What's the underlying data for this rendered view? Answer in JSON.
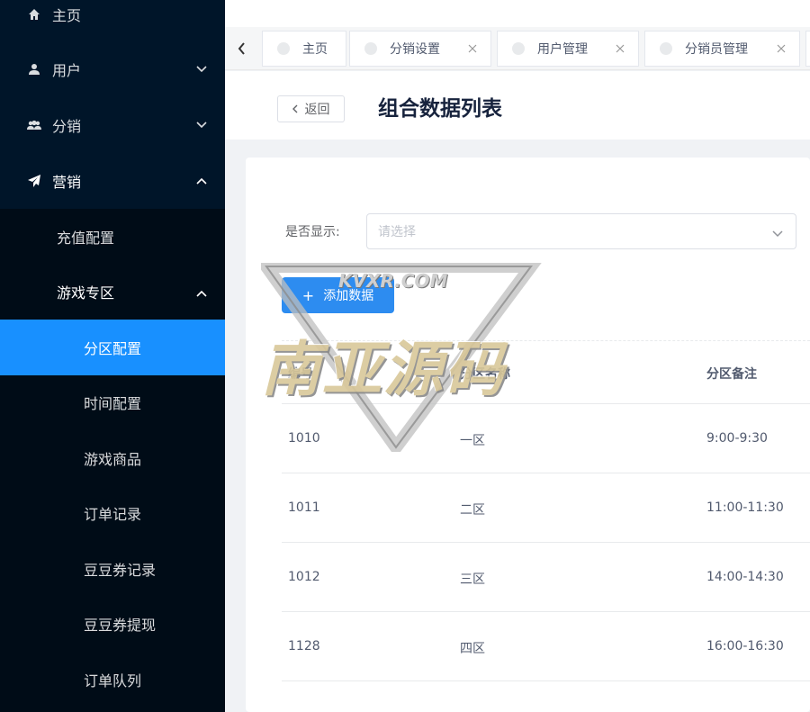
{
  "sidebar": {
    "top_items": [
      {
        "label": "主页",
        "icon": "home-icon",
        "expanded": null
      },
      {
        "label": "用户",
        "icon": "user-icon",
        "expanded": false
      },
      {
        "label": "分销",
        "icon": "group-icon",
        "expanded": false
      },
      {
        "label": "营销",
        "icon": "send-icon",
        "expanded": true
      }
    ],
    "marketing_children": [
      {
        "label": "充值配置"
      },
      {
        "label": "游戏专区",
        "expanded": true
      }
    ],
    "game_children": [
      {
        "label": "分区配置",
        "active": true
      },
      {
        "label": "时间配置"
      },
      {
        "label": "游戏商品"
      },
      {
        "label": "订单记录"
      },
      {
        "label": "豆豆券记录"
      },
      {
        "label": "豆豆券提现"
      },
      {
        "label": "订单队列"
      }
    ]
  },
  "tabs": [
    {
      "label": "主页",
      "closable": false
    },
    {
      "label": "分销设置",
      "closable": true
    },
    {
      "label": "用户管理",
      "closable": true
    },
    {
      "label": "分销员管理",
      "closable": true
    }
  ],
  "header": {
    "back_label": "返回",
    "title": "组合数据列表"
  },
  "filter": {
    "label": "是否显示:",
    "placeholder": "请选择"
  },
  "add_button_label": "添加数据",
  "table": {
    "columns": [
      "编号",
      "分区名称",
      "分区备注"
    ],
    "rows": [
      [
        "1010",
        "一区",
        "9:00-9:30"
      ],
      [
        "1011",
        "二区",
        "11:00-11:30"
      ],
      [
        "1012",
        "三区",
        "14:00-14:30"
      ],
      [
        "1128",
        "四区",
        "16:00-16:30"
      ]
    ]
  },
  "watermark": {
    "text": "南亚源码",
    "sub": "KVXR.COM"
  },
  "colors": {
    "sidebar_bg": "#001529",
    "submenu_bg": "#000c17",
    "active": "#1890ff",
    "primary_button": "#2d8cf0"
  }
}
